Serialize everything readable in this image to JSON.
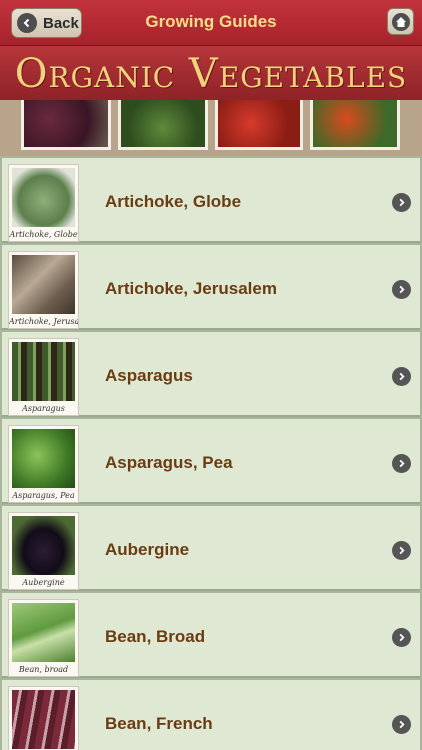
{
  "navbar": {
    "back_label": "Back",
    "title": "Growing Guides"
  },
  "banner": {
    "title": "Organic Vegetables"
  },
  "vegetables": [
    {
      "name": "Artichoke, Globe",
      "caption": "Artichoke, Globe"
    },
    {
      "name": "Artichoke, Jerusalem",
      "caption": "Artichoke, Jerusalem"
    },
    {
      "name": "Asparagus",
      "caption": "Asparagus"
    },
    {
      "name": "Asparagus, Pea",
      "caption": "Asparagus, Pea"
    },
    {
      "name": "Aubergine",
      "caption": "Aubergine"
    },
    {
      "name": "Bean, Broad",
      "caption": "Bean, broad"
    },
    {
      "name": "Bean, French",
      "caption": ""
    }
  ],
  "colors": {
    "nav_red": "#b02a33",
    "nav_title": "#f5dd8a",
    "banner_title": "#f0d27c",
    "row_bg": "#dfe8d2",
    "row_title": "#6b3c12"
  }
}
